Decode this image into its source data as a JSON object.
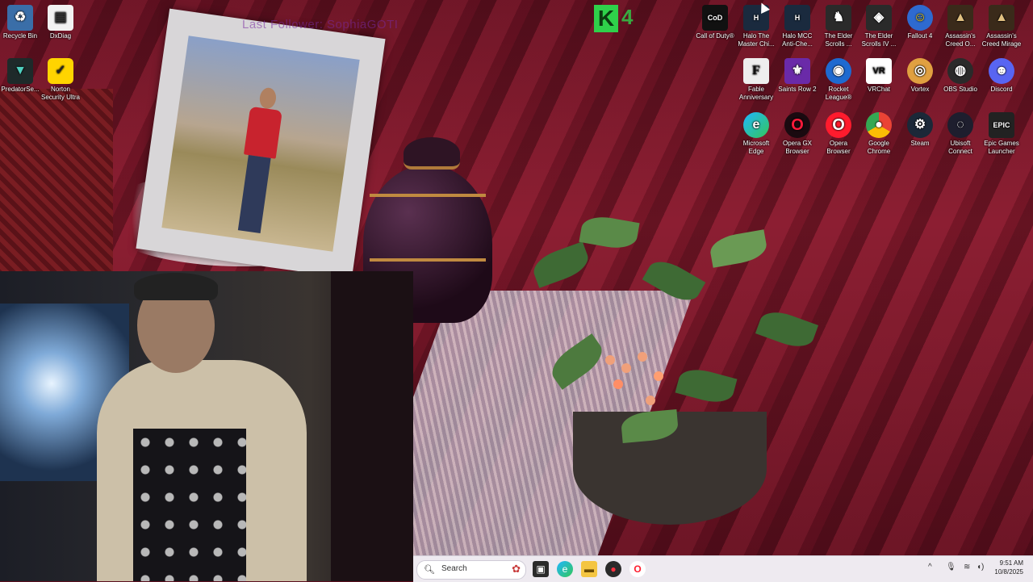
{
  "overlay": {
    "stream_text": "Last Follower: SophiaGOTI",
    "logo_letter": "K",
    "logo_number": "4"
  },
  "desktop_icons": {
    "recycle_bin": "Recycle Bin",
    "dxdiag": "DxDiag",
    "predator": "PredatorSe...",
    "norton": "Norton Security Ultra",
    "cod": "Call of Duty®",
    "halo_mc": "Halo The Master Chi...",
    "halo_mcc": "Halo MCC Anti-Che...",
    "elder_scrolls": "The Elder Scrolls ...",
    "elder_scrolls_iv": "The Elder Scrolls IV ...",
    "fallout4": "Fallout 4",
    "ac_o": "Assassin's Creed O...",
    "ac_mirage": "Assassin's Creed Mirage",
    "fable": "Fable Anniversary",
    "saints_row": "Saints Row 2",
    "rocket_league": "Rocket League®",
    "vrchat": "VRChat",
    "vortex": "Vortex",
    "obs": "OBS Studio",
    "discord": "Discord",
    "edge": "Microsoft Edge",
    "opera_gx": "Opera GX Browser",
    "opera": "Opera Browser",
    "chrome": "Google Chrome",
    "steam": "Steam",
    "ubisoft": "Ubisoft Connect",
    "epic": "Epic Games Launcher"
  },
  "taskbar": {
    "search_placeholder": "Search",
    "time": "9:51 AM",
    "date": "10/8/2025"
  },
  "colors": {
    "taskbar_bg": "#eeeaf0",
    "wallpaper_red": "#8a1a2e",
    "k_green": "#2fd14a"
  }
}
